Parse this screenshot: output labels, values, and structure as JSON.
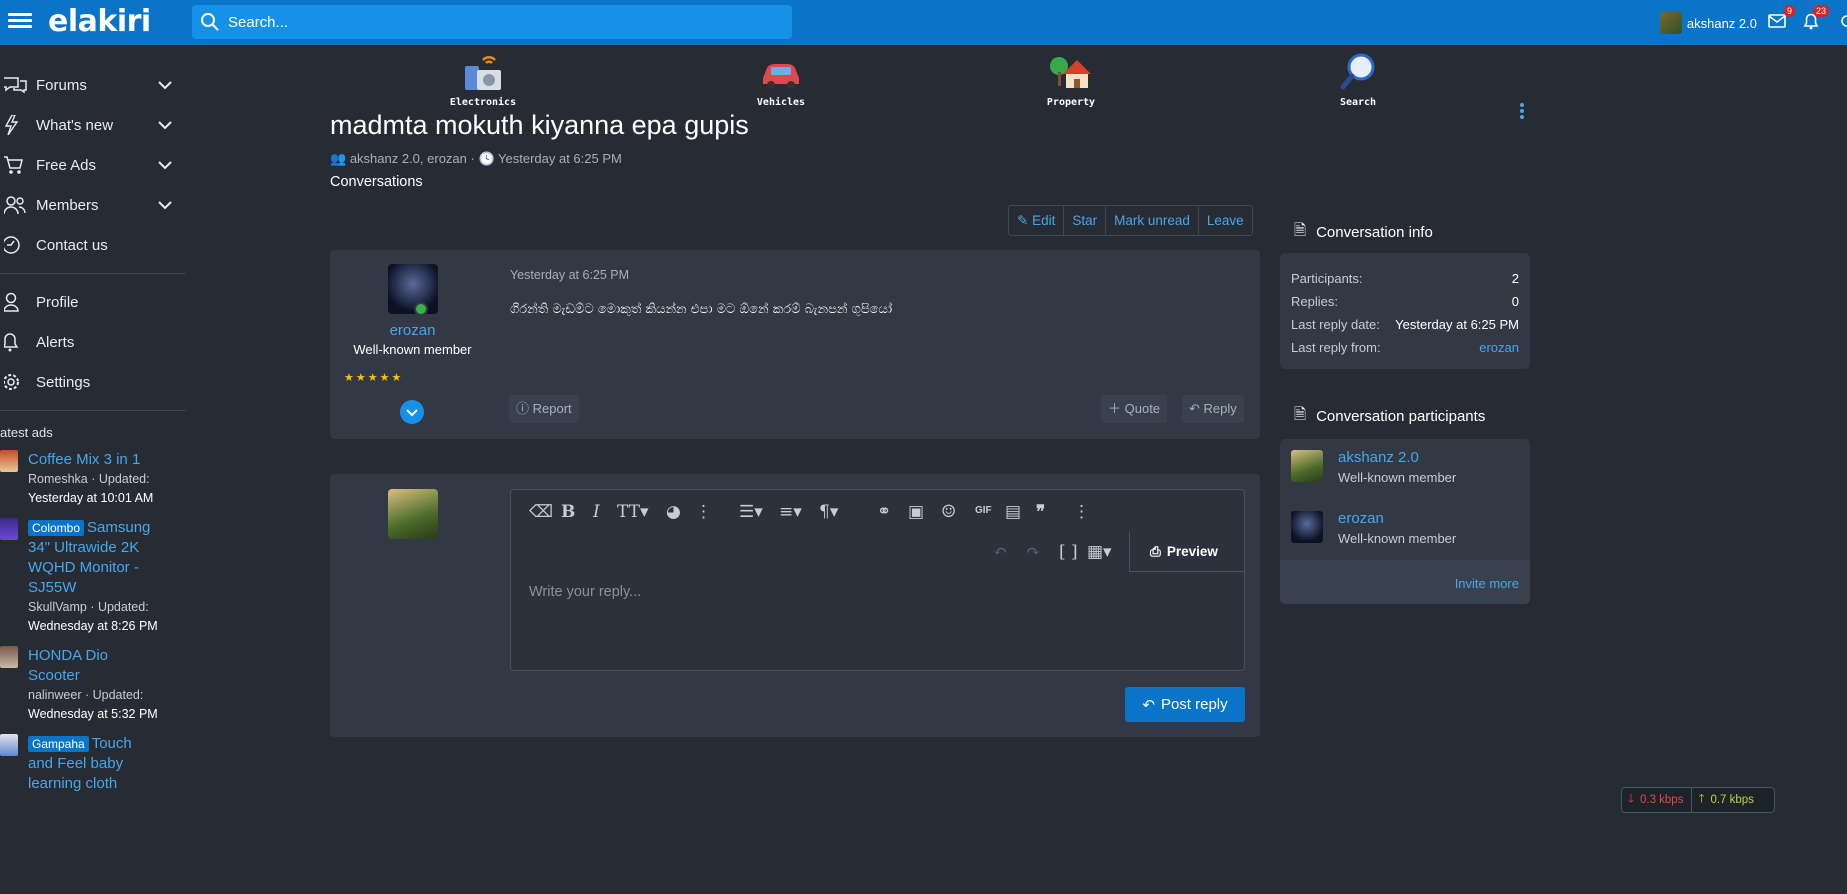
{
  "header": {
    "logo": "elakiri",
    "search_placeholder": "Search...",
    "username": "akshanz 2.0",
    "inbox_count": "9",
    "alerts_count": "23"
  },
  "sidebar": {
    "nav": [
      {
        "label": "Forums",
        "icon": "forum-icon",
        "expandable": true
      },
      {
        "label": "What's new",
        "icon": "bolt-icon",
        "expandable": true
      },
      {
        "label": "Free Ads",
        "icon": "cart-icon",
        "expandable": true
      },
      {
        "label": "Members",
        "icon": "members-icon",
        "expandable": true
      },
      {
        "label": "Contact us",
        "icon": "contact-icon",
        "expandable": false
      }
    ],
    "account": [
      {
        "label": "Profile",
        "icon": "user-icon"
      },
      {
        "label": "Alerts",
        "icon": "bell-icon"
      },
      {
        "label": "Settings",
        "icon": "gear-icon"
      }
    ],
    "latest_ads_title": "atest ads",
    "ads": [
      {
        "tag": "",
        "title": "Coffee Mix 3 in 1",
        "author": "Romeshka",
        "updated_label": "Updated:",
        "updated": "Yesterday at 10:01 AM"
      },
      {
        "tag": "Colombo",
        "title": "Samsung 34\" Ultrawide 2K WQHD Monitor - SJ55W",
        "author": "SkullVamp",
        "updated_label": "Updated:",
        "updated": "Wednesday at 8:26 PM"
      },
      {
        "tag": "",
        "title": "HONDA Dio Scooter",
        "author": "nalinweer",
        "updated_label": "Updated:",
        "updated": "Wednesday at 5:32 PM"
      },
      {
        "tag": "Gampaha",
        "title": "Touch and Feel baby learning cloth",
        "author": "",
        "updated_label": "",
        "updated": ""
      }
    ]
  },
  "categories": [
    {
      "label": "Electronics",
      "icon": "electronics-icon"
    },
    {
      "label": "Vehicles",
      "icon": "car-icon"
    },
    {
      "label": "Property",
      "icon": "house-icon"
    },
    {
      "label": "Search",
      "icon": "magnifier-icon"
    }
  ],
  "conversation": {
    "title": "madmta mokuth kiyanna epa gupis",
    "participants_line": "akshanz 2.0, erozan",
    "date": "Yesterday at 6:25 PM",
    "breadcrumb": "Conversations",
    "actions": [
      "Edit",
      "Star",
      "Mark unread",
      "Leave"
    ]
  },
  "message": {
    "author": "erozan",
    "role": "Well-known member",
    "time": "Yesterday at 6:25 PM",
    "body": "ගිරන්ති මැඩම්ට මොකුත් කියන්න එපා මට ඕනේ කරම් බැනපන් ගුපියෝ",
    "report": "Report",
    "quote": "Quote",
    "reply": "Reply"
  },
  "editor": {
    "placeholder": "Write your reply...",
    "preview": "Preview",
    "post": "Post reply"
  },
  "info": {
    "title": "Conversation info",
    "rows": [
      {
        "label": "Participants:",
        "value": "2"
      },
      {
        "label": "Replies:",
        "value": "0"
      },
      {
        "label": "Last reply date:",
        "value": "Yesterday at 6:25 PM"
      },
      {
        "label": "Last reply from:",
        "value": "erozan"
      }
    ]
  },
  "participants": {
    "title": "Conversation participants",
    "list": [
      {
        "name": "akshanz 2.0",
        "role": "Well-known member"
      },
      {
        "name": "erozan",
        "role": "Well-known member"
      }
    ],
    "invite": "Invite more"
  },
  "speed": {
    "down": "0.3 kbps",
    "up": "0.7 kbps"
  },
  "colors": {
    "brand": "#0a74c8",
    "background": "#272b34",
    "card": "#323844",
    "link": "#47a7eb"
  }
}
